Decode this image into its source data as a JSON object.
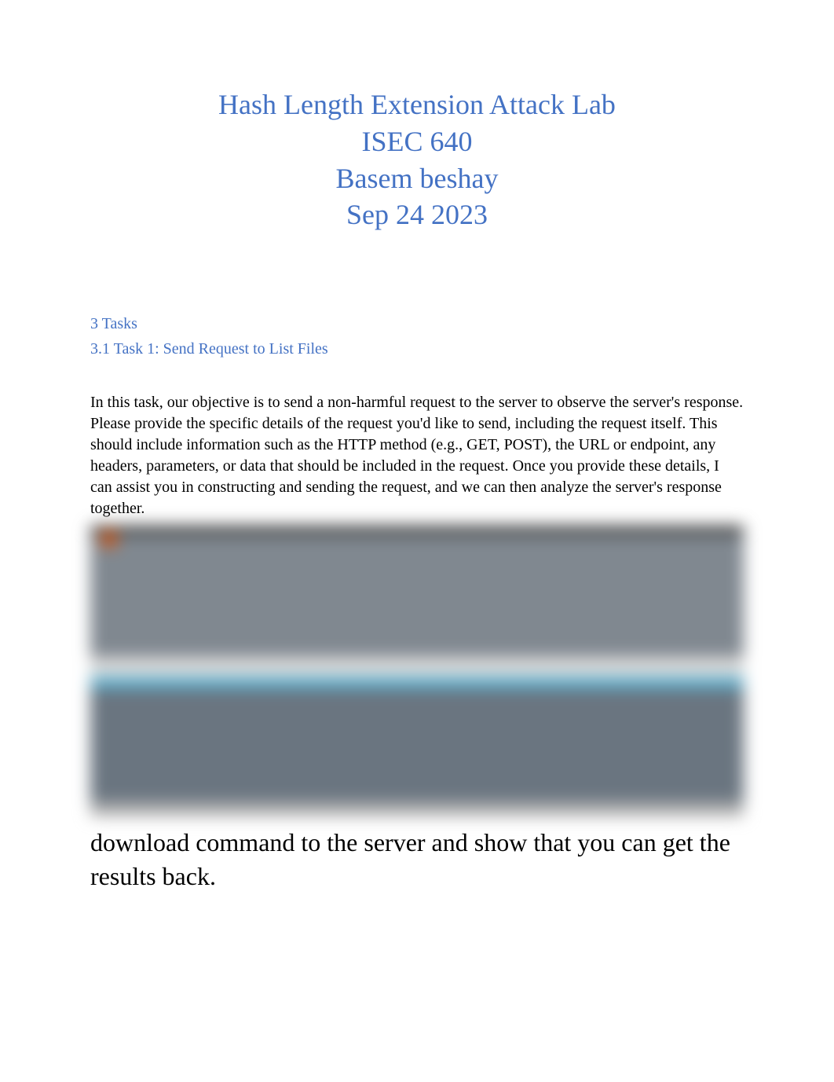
{
  "title": {
    "line1": "Hash Length Extension Attack Lab",
    "line2": "ISEC 640",
    "line3": "Basem beshay",
    "line4": "Sep 24 2023"
  },
  "sections": {
    "tasks_heading": "3 Tasks",
    "task1_heading": "3.1 Task 1: Send Request to List Files",
    "task1_body": "In this task, our objective is to send a non-harmful request to the server to observe the server's response. Please provide the specific details of the request you'd like to send, including the request itself. This should include information such as the HTTP method (e.g., GET, POST), the URL or endpoint, any headers, parameters, or data that should be included in the request. Once you provide these details, I can assist you in constructing and sending the request, and we can then analyze the server's response together.",
    "task1_followup": "download command to the server and show that you can get the results back."
  }
}
